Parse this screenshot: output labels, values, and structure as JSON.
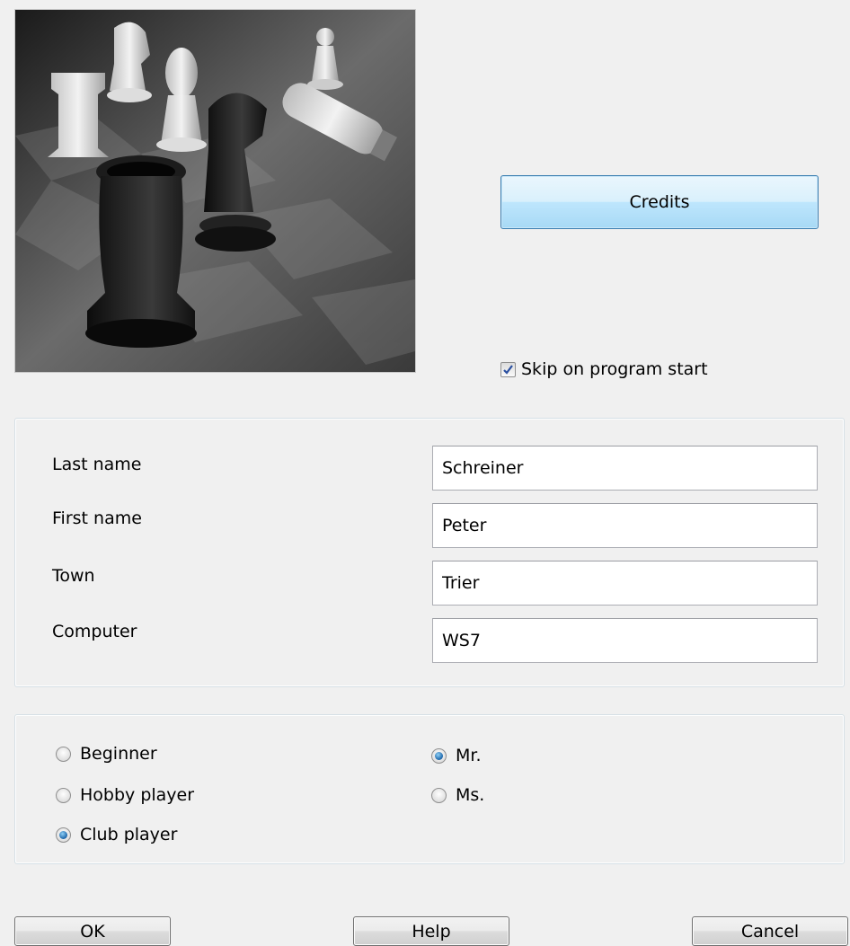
{
  "header": {
    "picture_icon": "chess-pieces-photo",
    "credits_label": "Credits",
    "skip_label": "Skip on program start",
    "skip_checked": true
  },
  "user_info": {
    "fields": [
      {
        "label": "Last name",
        "value": "Schreiner"
      },
      {
        "label": "First name",
        "value": "Peter"
      },
      {
        "label": "Town",
        "value": "Trier"
      },
      {
        "label": "Computer",
        "value": "WS7"
      }
    ]
  },
  "player": {
    "levels": [
      {
        "label": "Beginner",
        "selected": false
      },
      {
        "label": "Hobby player",
        "selected": false
      },
      {
        "label": "Club player",
        "selected": true
      }
    ],
    "salutations": [
      {
        "label": "Mr.",
        "selected": true
      },
      {
        "label": "Ms.",
        "selected": false
      }
    ]
  },
  "footer": {
    "ok_label": "OK",
    "help_label": "Help",
    "cancel_label": "Cancel"
  },
  "colors": {
    "accent": "#3c7fb1",
    "window_bg": "#f0f0f0"
  }
}
